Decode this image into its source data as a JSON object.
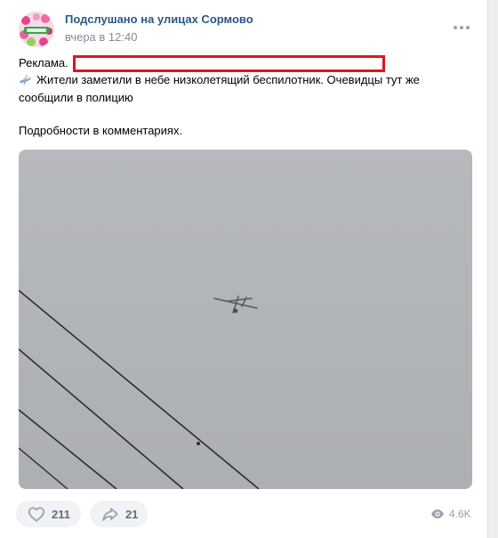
{
  "post": {
    "author": "Подслушано на улицах Сормово",
    "time": "вчера в 12:40",
    "ad_label": "Реклама.",
    "body_line1": "Жители заметили в небе низколетящий беспилотник. Очевидцы тут же сообщили в полицию",
    "body_line2": "Подробности в комментариях.",
    "emoji_icon": "airplane-icon",
    "redaction_color": "#e0141c"
  },
  "actions": {
    "likes": "211",
    "shares": "21",
    "views": "4.6K"
  },
  "colors": {
    "link": "#2a5885",
    "secondary": "#818c99",
    "button_bg": "#f0f2f5",
    "button_text": "#626d7a"
  }
}
